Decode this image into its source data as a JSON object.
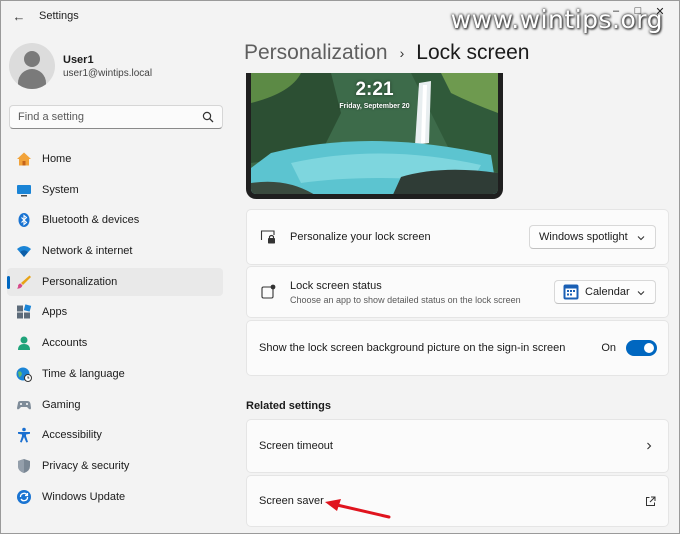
{
  "window": {
    "title": "Settings",
    "back_glyph": "←",
    "minimize": "–",
    "maximize": "□",
    "close": "✕"
  },
  "watermark": "www.wintips.org",
  "user": {
    "name": "User1",
    "email": "user1@wintips.local"
  },
  "search": {
    "placeholder": "Find a setting"
  },
  "nav": [
    {
      "label": "Home",
      "icon": "home-icon",
      "active": false
    },
    {
      "label": "System",
      "icon": "system-icon",
      "active": false
    },
    {
      "label": "Bluetooth & devices",
      "icon": "bluetooth-icon",
      "active": false
    },
    {
      "label": "Network & internet",
      "icon": "wifi-icon",
      "active": false
    },
    {
      "label": "Personalization",
      "icon": "brush-icon",
      "active": true
    },
    {
      "label": "Apps",
      "icon": "apps-icon",
      "active": false
    },
    {
      "label": "Accounts",
      "icon": "accounts-icon",
      "active": false
    },
    {
      "label": "Time & language",
      "icon": "globe-clock-icon",
      "active": false
    },
    {
      "label": "Gaming",
      "icon": "gamepad-icon",
      "active": false
    },
    {
      "label": "Accessibility",
      "icon": "accessibility-icon",
      "active": false
    },
    {
      "label": "Privacy & security",
      "icon": "shield-icon",
      "active": false
    },
    {
      "label": "Windows Update",
      "icon": "update-icon",
      "active": false
    }
  ],
  "breadcrumb": {
    "parent": "Personalization",
    "separator": "›",
    "current": "Lock screen"
  },
  "preview": {
    "time": "2:21",
    "date": "Friday, September 20"
  },
  "personalize": {
    "title": "Personalize your lock screen",
    "value": "Windows spotlight"
  },
  "status": {
    "title": "Lock screen status",
    "desc": "Choose an app to show detailed status on the lock screen",
    "value": "Calendar"
  },
  "signin": {
    "title": "Show the lock screen background picture on the sign-in screen",
    "state": "On",
    "enabled": true
  },
  "related": {
    "title": "Related settings",
    "timeout": "Screen timeout",
    "saver": "Screen saver"
  },
  "colors": {
    "accent": "#0067c0",
    "annotation_arrow": "#e0141e"
  }
}
